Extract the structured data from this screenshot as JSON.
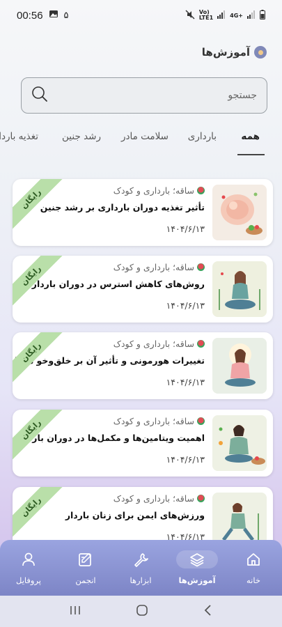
{
  "status_bar": {
    "time": "00:56",
    "notification_count": "۵",
    "network_label": "Vo)\nLTE1",
    "network_type": "4G+"
  },
  "header": {
    "title": "آموزش‌ها"
  },
  "search": {
    "placeholder": "جستجو"
  },
  "tabs": [
    {
      "label": "همه",
      "active": true
    },
    {
      "label": "بارداری"
    },
    {
      "label": "سلامت مادر"
    },
    {
      "label": "رشد جنین"
    },
    {
      "label": "تغذیه باردا"
    }
  ],
  "cards": [
    {
      "source": "ساقه؛ بارداری و کودک",
      "title": "تأثیر تغذیه دوران بارداری بر رشد جنین",
      "date": "۱۴۰۴/۶/۱۳",
      "badge": "رایگان"
    },
    {
      "source": "ساقه؛ بارداری و کودک",
      "title": "روش‌های کاهش استرس در دوران بارداری",
      "date": "۱۴۰۴/۶/۱۳",
      "badge": "رایگان"
    },
    {
      "source": "ساقه؛ بارداری و کودک",
      "title": "تغییرات هورمونی و تأثیر آن بر خلق‌وخو در بارداری",
      "date": "۱۴۰۴/۶/۱۳",
      "badge": "رایگان"
    },
    {
      "source": "ساقه؛ بارداری و کودک",
      "title": "اهمیت ویتامین‌ها و مکمل‌ها در دوران بارداری",
      "date": "۱۴۰۴/۶/۱۳",
      "badge": "رایگان"
    },
    {
      "source": "ساقه؛ بارداری و کودک",
      "title": "ورزش‌های ایمن برای زنان باردار",
      "date": "۱۴۰۴/۶/۱۳",
      "badge": "رایگان"
    }
  ],
  "bottom_nav": [
    {
      "label": "خانه",
      "icon": "home-icon"
    },
    {
      "label": "آموزش‌ها",
      "icon": "layers-icon",
      "active": true
    },
    {
      "label": "ابزارها",
      "icon": "wrench-icon"
    },
    {
      "label": "انجمن",
      "icon": "edit-icon"
    },
    {
      "label": "پروفایل",
      "icon": "user-icon"
    }
  ],
  "colors": {
    "nav_bg": "#8b93d3",
    "badge_bg": "#b9dfa9",
    "accent": "#7d85c6"
  }
}
